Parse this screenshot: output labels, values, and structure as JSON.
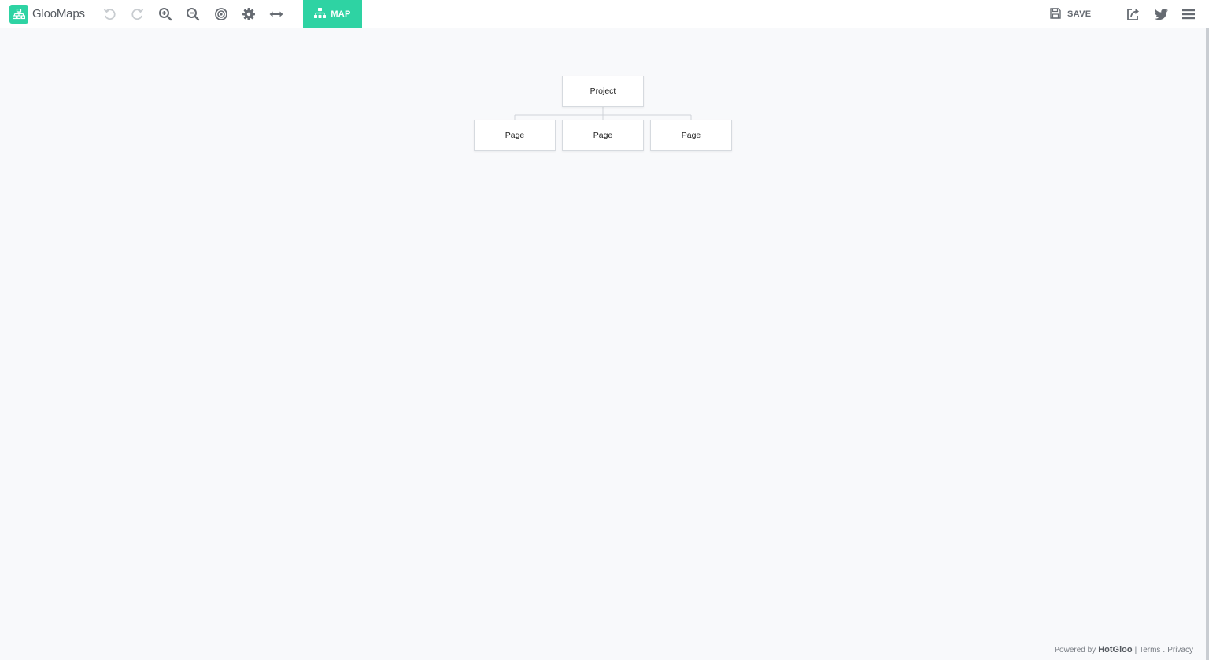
{
  "app": {
    "name": "GlooMaps",
    "accent_color": "#2ed3a3"
  },
  "toolbar": {
    "tools": [
      {
        "name": "undo-icon",
        "enabled": false
      },
      {
        "name": "redo-icon",
        "enabled": false
      },
      {
        "name": "zoom-in-icon",
        "enabled": true
      },
      {
        "name": "zoom-out-icon",
        "enabled": true
      },
      {
        "name": "target-icon",
        "enabled": true
      },
      {
        "name": "gear-icon",
        "enabled": true
      },
      {
        "name": "arrows-horizontal-icon",
        "enabled": true
      }
    ],
    "map_tab_label": "MAP",
    "save_label": "SAVE",
    "right_icons": [
      "share-icon",
      "twitter-icon",
      "menu-icon"
    ]
  },
  "sitemap": {
    "root": {
      "label": "Project"
    },
    "children": [
      {
        "label": "Page"
      },
      {
        "label": "Page"
      },
      {
        "label": "Page"
      }
    ]
  },
  "footer": {
    "powered_by": "Powered by",
    "brand": "HotGloo",
    "separator": "|",
    "terms": "Terms",
    "dot": ".",
    "privacy": "Privacy"
  }
}
